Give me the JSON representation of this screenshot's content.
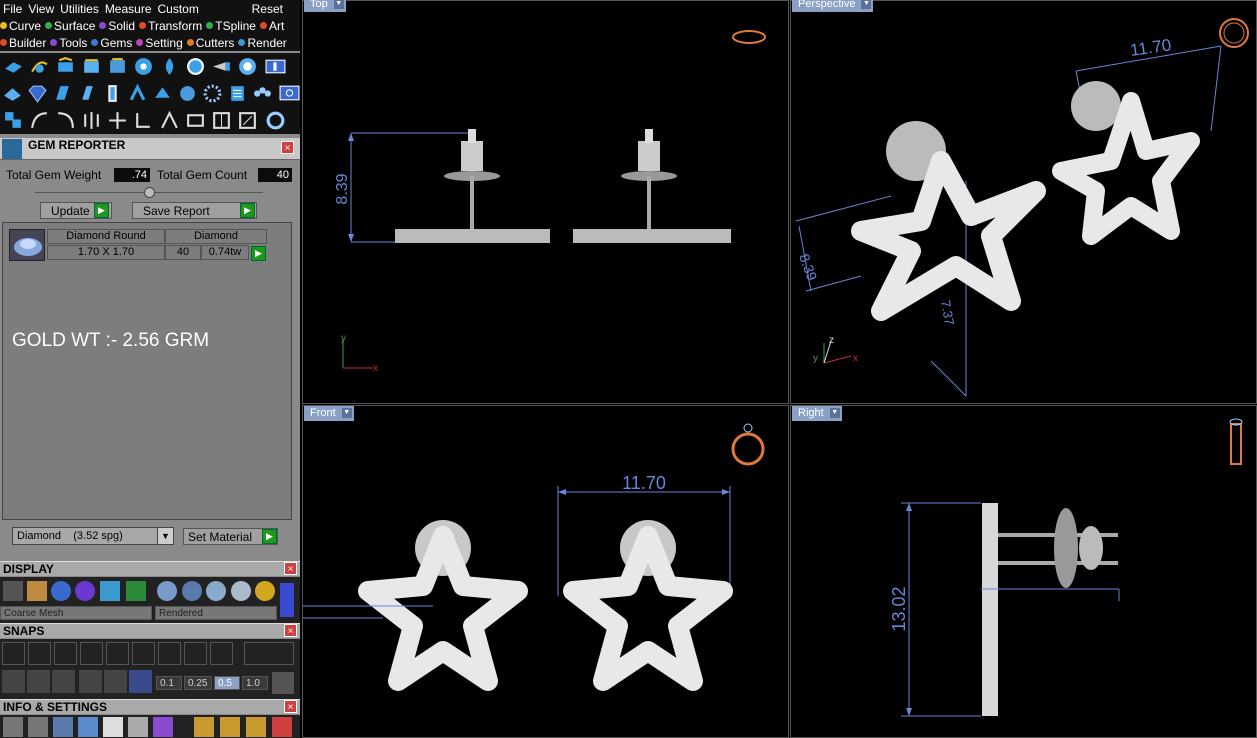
{
  "menu": [
    "File",
    "View",
    "Utilities",
    "Measure",
    "Custom",
    "Reset"
  ],
  "plugins_row1": [
    {
      "label": "Curve",
      "color": "#e8c020"
    },
    {
      "label": "Surface",
      "color": "#2fb04a"
    },
    {
      "label": "Solid",
      "color": "#8a4ad0"
    },
    {
      "label": "Transform",
      "color": "#e04a2a"
    },
    {
      "label": "TSpline",
      "color": "#2fb04a"
    },
    {
      "label": "Art",
      "color": "#e04a2a"
    }
  ],
  "plugins_row2": [
    {
      "label": "Builder",
      "color": "#e04a2a"
    },
    {
      "label": "Tools",
      "color": "#8a4ad0"
    },
    {
      "label": "Gems",
      "color": "#3a7ad0"
    },
    {
      "label": "Setting",
      "color": "#c040c0"
    },
    {
      "label": "Cutters",
      "color": "#e07a20"
    },
    {
      "label": "Render",
      "color": "#3a9ad0"
    }
  ],
  "gem_reporter": {
    "title": "GEM REPORTER",
    "total_weight_label": "Total Gem Weight",
    "total_weight_value": ".74",
    "total_count_label": "Total Gem Count",
    "total_count_value": "40",
    "update_label": "Update",
    "save_report_label": "Save Report",
    "row": {
      "shape": "Diamond Round",
      "size": "1.70 X 1.70",
      "material": "Diamond",
      "count": "40",
      "weight": "0.74tw"
    },
    "note": "GOLD WT :- 2.56 GRM",
    "material_select": "Diamond    (3.52 spg)",
    "set_material_label": "Set Material"
  },
  "display": {
    "title": "DISPLAY",
    "mesh": "Coarse Mesh",
    "render": "Rendered"
  },
  "snaps": {
    "title": "SNAPS",
    "steps": [
      "0.1",
      "0.25",
      "0.5",
      "1.0"
    ]
  },
  "info": {
    "title": "INFO & SETTINGS"
  },
  "viewports": {
    "top": {
      "label": "Top",
      "dim": "8.39"
    },
    "perspective": {
      "label": "Perspective",
      "dim_a": "11.70",
      "dim_b": "8.39",
      "dim_c": "7.37"
    },
    "front": {
      "label": "Front",
      "dim": "11.70"
    },
    "right": {
      "label": "Right",
      "dim": "13.02"
    }
  },
  "axes": {
    "x": "x",
    "y": "y",
    "z": "z"
  },
  "colors": {
    "dimension": "#6a86d8",
    "ui_bg": "#8a8a8a",
    "accent_green": "#1d9a1d"
  }
}
